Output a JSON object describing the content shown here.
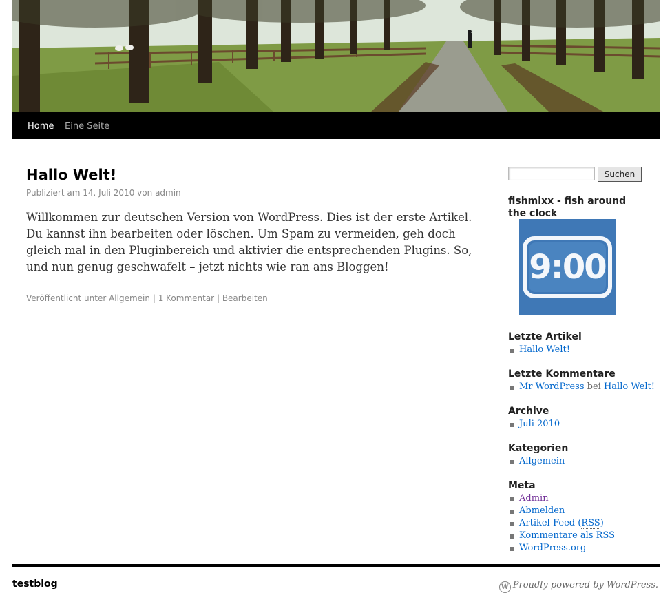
{
  "nav": {
    "items": [
      {
        "label": "Home"
      },
      {
        "label": "Eine Seite"
      }
    ]
  },
  "post": {
    "title": "Hallo Welt!",
    "meta_prefix": "Publiziert am",
    "date": "14. Juli 2010",
    "meta_by": "von",
    "author": "admin",
    "body": "Willkommen zur deutschen Version von WordPress. Dies ist der erste Artikel. Du kannst ihn bearbeiten oder löschen. Um Spam zu vermeiden, geh doch gleich mal in den Pluginbereich und aktivier die entsprechenden Plugins. So, und nun genug geschwafelt – jetzt nichts wie ran ans Bloggen!",
    "footer_prefix": "Veröffentlicht unter",
    "category": "Allgemein",
    "sep": "|",
    "comments": "1 Kommentar",
    "edit": "Bearbeiten"
  },
  "sidebar": {
    "search": {
      "value": "",
      "button": "Suchen"
    },
    "image_widget_title": "fishmixx - fish around the clock",
    "image_text": "9:00",
    "recent_posts": {
      "title": "Letzte Artikel",
      "items": [
        "Hallo Welt!"
      ]
    },
    "recent_comments": {
      "title": "Letzte Kommentare",
      "author": "Mr WordPress",
      "joiner": "bei",
      "post": "Hallo Welt!"
    },
    "archive": {
      "title": "Archive",
      "items": [
        "Juli 2010"
      ]
    },
    "categories": {
      "title": "Kategorien",
      "items": [
        "Allgemein"
      ]
    },
    "meta": {
      "title": "Meta",
      "admin": "Admin",
      "logout": "Abmelden",
      "feed_prefix": "Artikel-Feed (",
      "feed_rss": "RSS",
      "feed_suffix": ")",
      "comments_prefix": "Kommentare als ",
      "comments_rss": "RSS",
      "wordpress_org": "WordPress.org"
    }
  },
  "footer": {
    "site_name": "testblog",
    "powered": "Proudly powered by WordPress.",
    "wp_icon_letter": "W"
  },
  "colors": {
    "link": "#0066cc",
    "visited_link": "#743399",
    "nav_background": "#000000"
  }
}
